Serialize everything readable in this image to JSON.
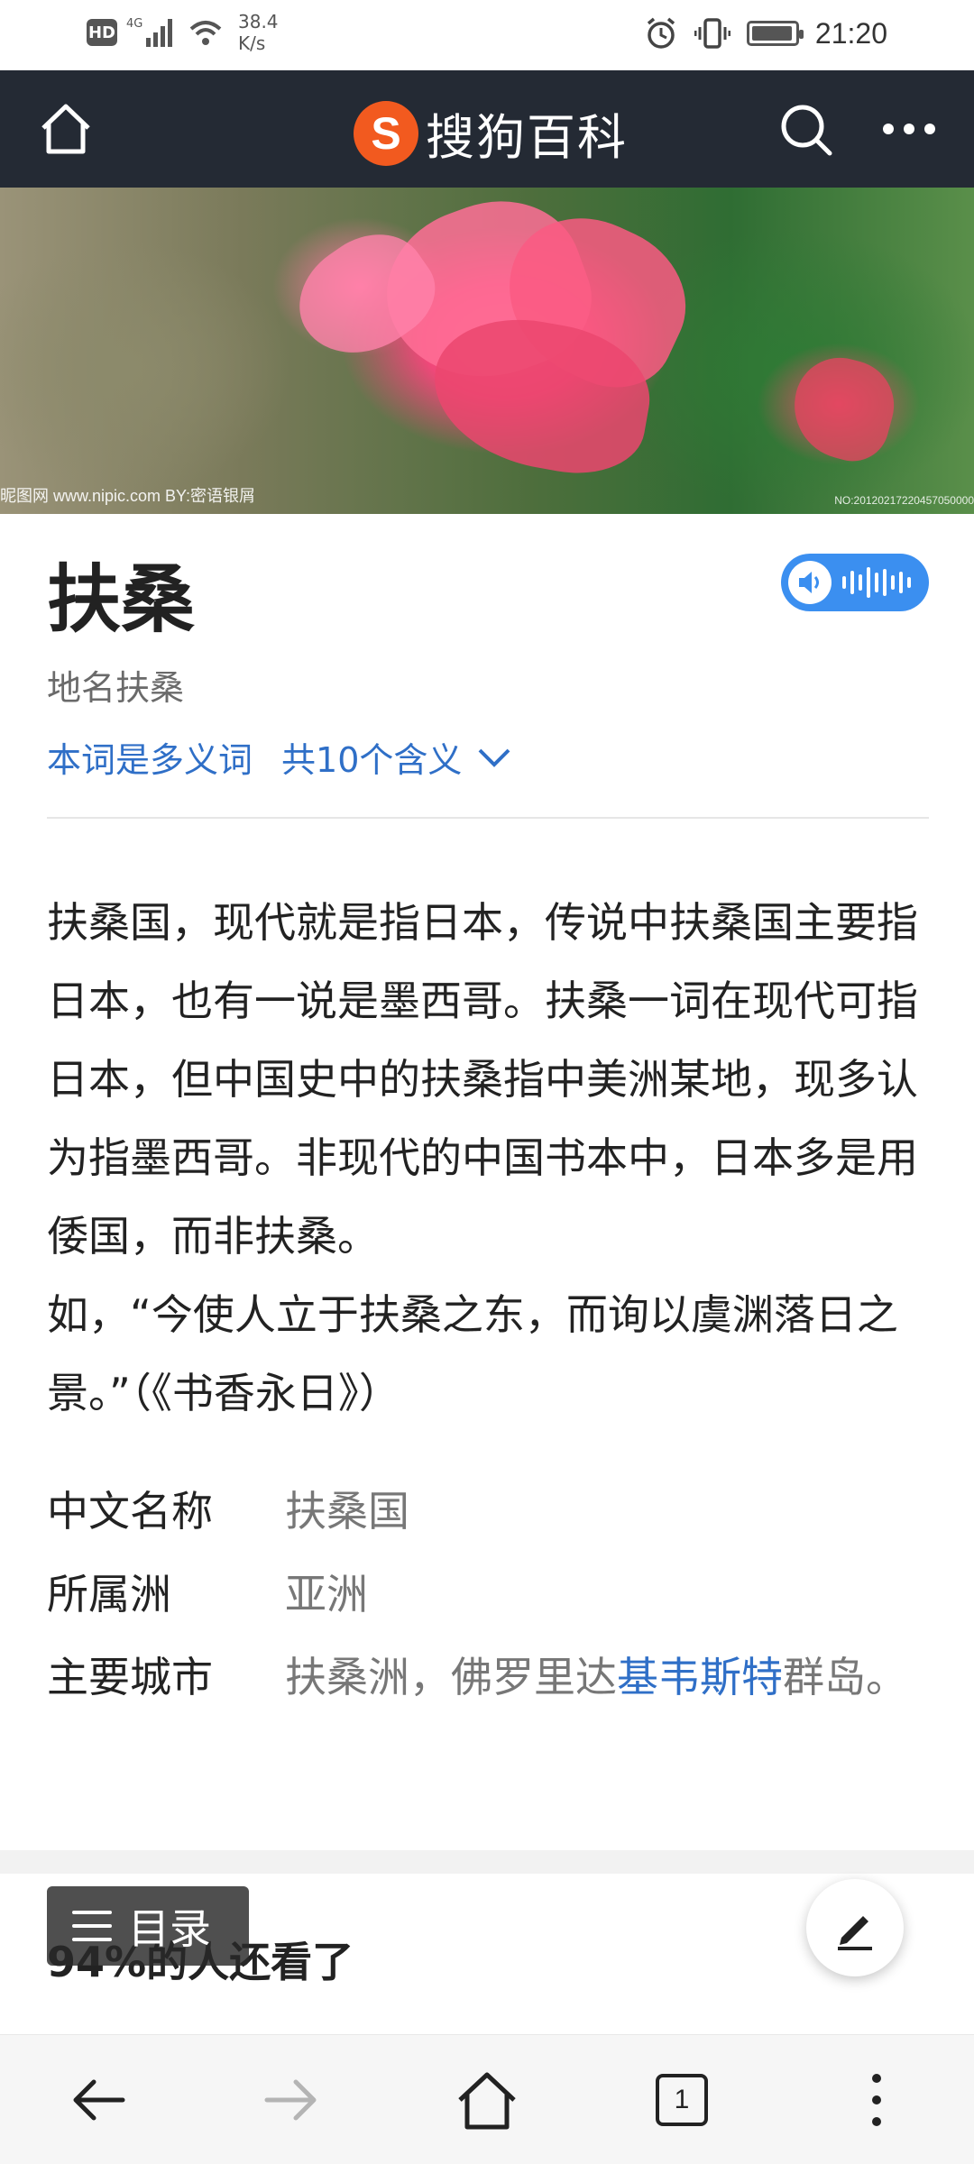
{
  "status_bar": {
    "hd_badge": "HD",
    "network_type": "4G",
    "net_speed_value": "38.4",
    "net_speed_unit": "K/s",
    "time": "21:20",
    "battery_level": 0.95
  },
  "app_bar": {
    "brand_logo_letter": "S",
    "brand_name": "搜狗百科"
  },
  "hero": {
    "watermark": "昵图网 www.nipic.com  BY:密语银屑",
    "image_id": "NO:20120217220457050000"
  },
  "article": {
    "title": "扶桑",
    "subtitle": "地名扶桑",
    "polysemy_label": "本词是多义词",
    "polysemy_count": "共10个含义",
    "paragraph": "扶桑国，现代就是指日本，传说中扶桑国主要指日本，也有一说是墨西哥。扶桑一词在现代可指日本，但中国史中的扶桑指中美洲某地，现多认为指墨西哥。非现代的中国书本中，日本多是用倭国，而非扶桑。",
    "quote": "如，“今使人立于扶桑之东，而询以虞渊落日之景。”（《书香永日》）"
  },
  "info": {
    "rows": [
      {
        "label": "中文名称",
        "value": "扶桑国"
      },
      {
        "label": "所属洲",
        "value": "亚洲"
      }
    ],
    "cities_label": "主要城市",
    "cities_before": "扶桑洲，佛罗里达",
    "cities_link": "基韦斯特",
    "cities_after": "群岛。"
  },
  "also_viewed": "94%的人还看了",
  "toc_label": "目录",
  "bottom_nav": {
    "tab_count": "1"
  },
  "colors": {
    "app_bar_bg": "#242a34",
    "brand_orange": "#f25a1f",
    "link_blue": "#2f6fc7",
    "audio_blue": "#3b8ff0"
  },
  "icons": [
    "home-icon",
    "search-icon",
    "more-icon",
    "speaker-icon",
    "menu-icon",
    "edit-icon",
    "back-arrow-icon",
    "forward-arrow-icon",
    "tabs-icon",
    "overflow-icon"
  ]
}
